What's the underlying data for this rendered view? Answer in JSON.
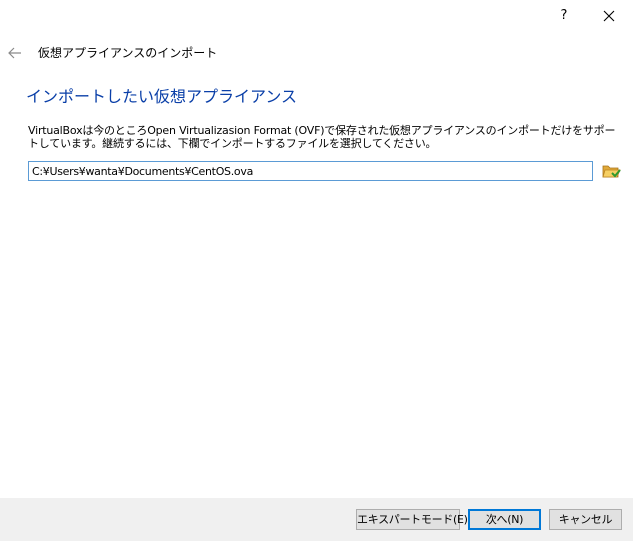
{
  "titlebar": {
    "help_label": "?",
    "close_icon": "close-icon"
  },
  "header": {
    "back_icon": "back-arrow-icon",
    "title": "仮想アプライアンスのインポート"
  },
  "main": {
    "heading": "インポートしたい仮想アプライアンス",
    "description": "VirtualBoxは今のところOpen Virtualizasion Format (OVF)で保存された仮想アプライアンスのインポートだけをサポートしています。継続するには、下欄でインポートするファイルを選択してください。",
    "file_path": {
      "value": "C:¥Users¥wanta¥Documents¥CentOS.ova",
      "browse_icon": "folder-open-icon"
    }
  },
  "footer": {
    "expert_mode_label": "エキスパートモード(E)",
    "next_label": "次へ(N)",
    "cancel_label": "キャンセル"
  },
  "colors": {
    "heading": "#0a3fa8",
    "input_border": "#5b9bd5",
    "default_button_border": "#0078d7",
    "button_bar": "#f0f0f0"
  }
}
